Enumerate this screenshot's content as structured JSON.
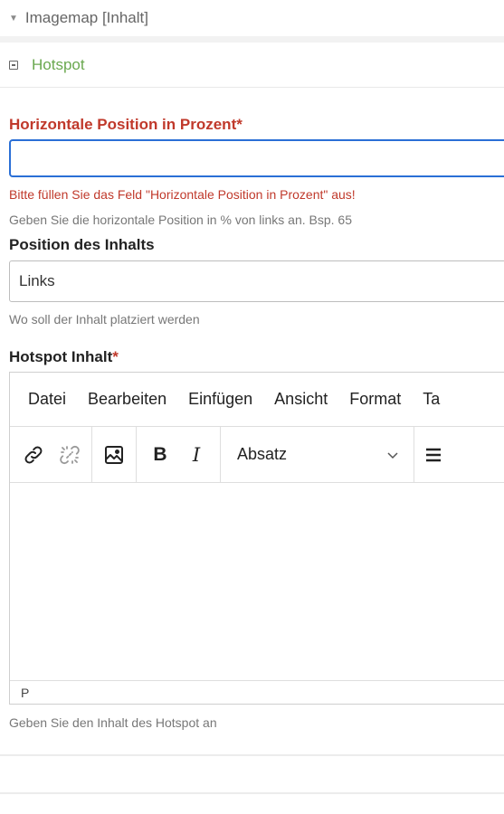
{
  "panel": {
    "title": "Imagemap [Inhalt]"
  },
  "group": {
    "title": "Hotspot"
  },
  "horizontal": {
    "label": "Horizontale Position in Prozent",
    "required_mark": "*",
    "value": "",
    "error": "Bitte füllen Sie das Feld \"Horizontale Position in Prozent\" aus!",
    "help": "Geben Sie die horizontale Position in % von links an. Bsp. 65"
  },
  "position": {
    "label": "Position des Inhalts",
    "value": "Links",
    "help": "Wo soll der Inhalt platziert werden"
  },
  "content": {
    "label": "Hotspot Inhalt",
    "required_mark": "*",
    "help": "Geben Sie den Inhalt des Hotspot an"
  },
  "editor": {
    "menu": [
      "Datei",
      "Bearbeiten",
      "Einfügen",
      "Ansicht",
      "Format",
      "Ta"
    ],
    "format_value": "Absatz",
    "bold_label": "B",
    "italic_label": "I",
    "status_path": "P"
  }
}
